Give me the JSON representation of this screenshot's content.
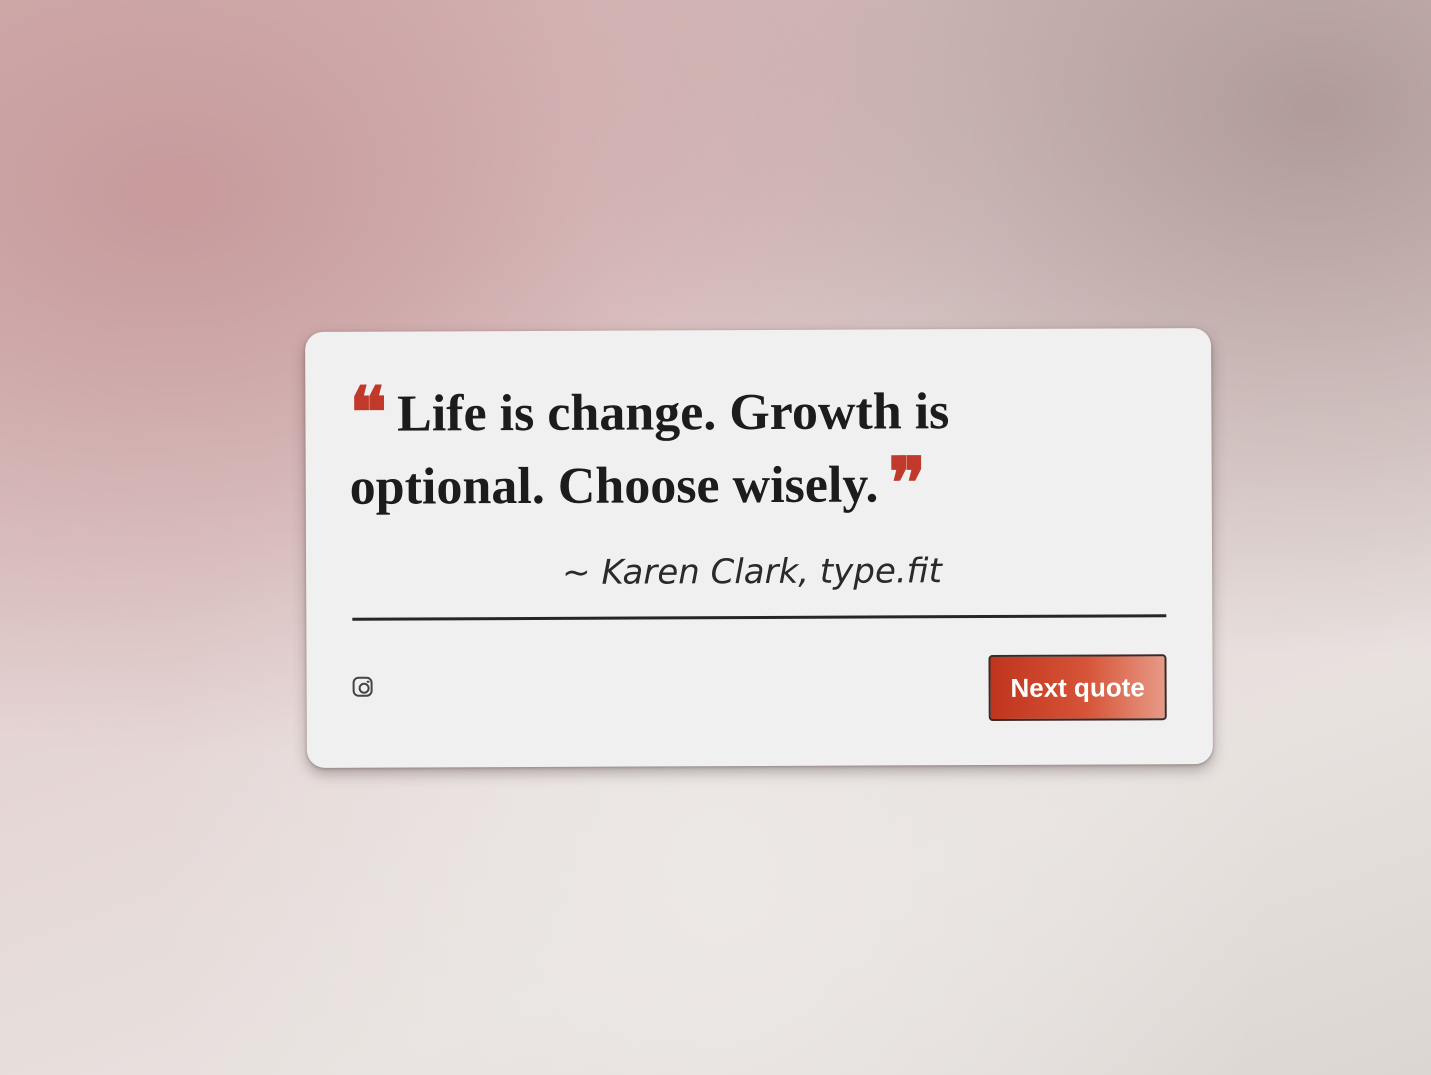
{
  "quote": {
    "open_mark": "❝",
    "text": "Life is change. Growth is optional. Choose wisely.",
    "close_mark": "❞",
    "author": "~ Karen Clark, type.fit"
  },
  "footer": {
    "social_icon": "instagram-icon",
    "next_button_label": "Next quote"
  },
  "colors": {
    "accent": "#c0392b",
    "text": "#1c1c1c",
    "card_background": "#f1f0f0"
  }
}
